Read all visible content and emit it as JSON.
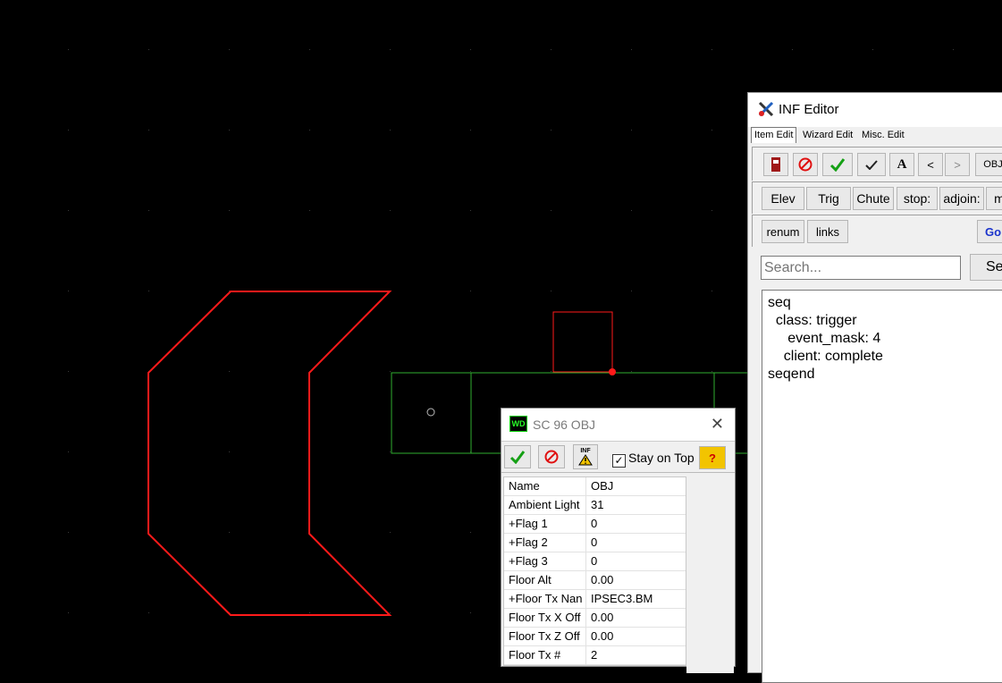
{
  "inf_editor": {
    "title": "INF Editor",
    "tabs": [
      "Item Edit",
      "Wizard Edit",
      "Misc. Edit"
    ],
    "toolbar": {
      "font_label": "A",
      "prev_label": "<",
      "next_label": ">",
      "obj_label": "OBJ"
    },
    "type_buttons": [
      "Elev",
      "Trig",
      "Chute",
      "stop:",
      "adjoin:",
      "m"
    ],
    "row3_buttons": [
      "renum",
      "links"
    ],
    "go_label": "Go",
    "search_placeholder": "Search...",
    "search_button_label": "Se",
    "code_lines": [
      "seq",
      "  class: trigger",
      "     event_mask: 4",
      "    client: complete",
      "seqend"
    ]
  },
  "sector_dialog": {
    "logo_text": "WD",
    "title": "SC 96  OBJ",
    "close_label": "✕",
    "inf_icon_label": "INF",
    "stay_on_top_label": "Stay on Top",
    "stay_on_top_checked": true,
    "help_label": "?",
    "properties": [
      {
        "name": "Name",
        "value": "OBJ"
      },
      {
        "name": "Ambient Light",
        "value": "31"
      },
      {
        "name": "+Flag 1",
        "value": "0"
      },
      {
        "name": "+Flag 2",
        "value": "0"
      },
      {
        "name": "+Flag 3",
        "value": "0"
      },
      {
        "name": "Floor Alt",
        "value": "0.00"
      },
      {
        "name": "+Floor Tx Nan",
        "value": "IPSEC3.BM"
      },
      {
        "name": "Floor Tx X Off",
        "value": "0.00"
      },
      {
        "name": "Floor Tx Z Off",
        "value": "0.00"
      },
      {
        "name": "Floor Tx #",
        "value": "2"
      }
    ]
  },
  "colors": {
    "map_background": "#000000",
    "selected_sector": "#ff0000",
    "sector_outline": "#2fae2f",
    "grid_dot": "#3a3a3a"
  }
}
